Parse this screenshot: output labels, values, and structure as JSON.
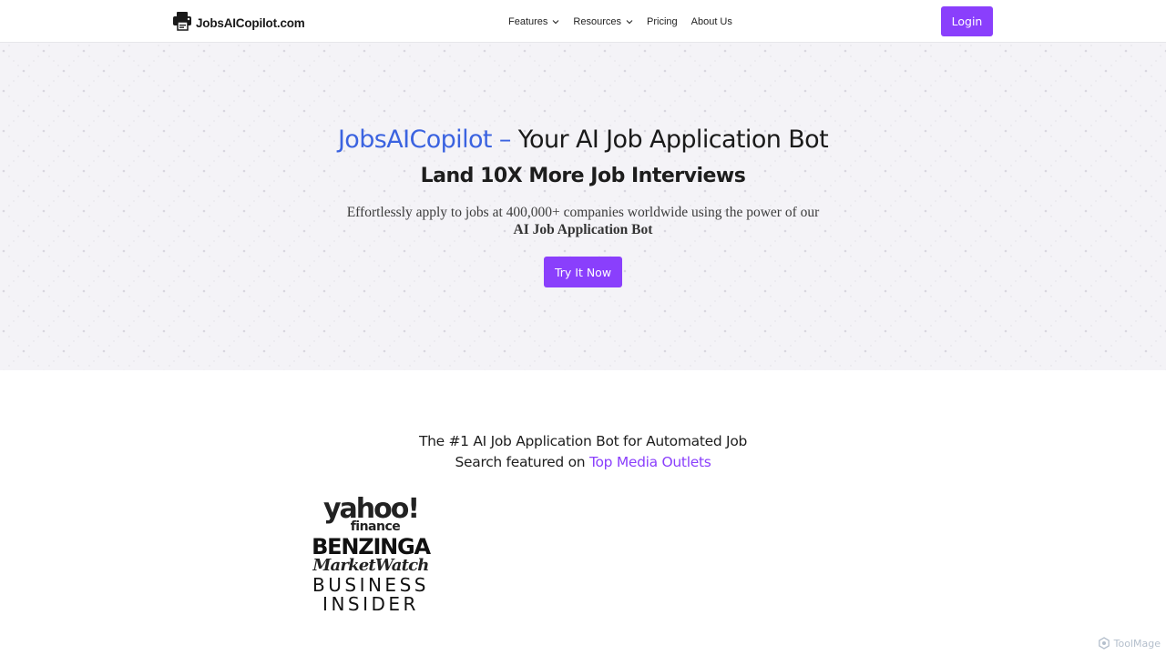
{
  "nav": {
    "logo_text": "JobsAICopilot.com",
    "logo_icon": "printer-logo-icon",
    "items": [
      {
        "label": "Features",
        "dropdown": true
      },
      {
        "label": "Resources",
        "dropdown": true
      },
      {
        "label": "Pricing",
        "dropdown": false
      },
      {
        "label": "About Us",
        "dropdown": false
      }
    ],
    "login_label": "Login"
  },
  "hero": {
    "title_brand": "JobsAICopilot –",
    "title_rest": " Your AI Job Application Bot",
    "subtitle": "Land 10X More Job Interviews",
    "description": "Effortlessly apply to jobs at 400,000+ companies worldwide using the power of our",
    "description_strong": "AI Job Application Bot",
    "cta_label": "Try It Now"
  },
  "featured": {
    "line1": "The #1 AI Job Application Bot for Automated Job",
    "line2_prefix": "Search featured on ",
    "line2_highlight": "Top Media Outlets"
  },
  "media_logos": {
    "yahoo_main": "yahoo!",
    "yahoo_sub": "finance",
    "benzinga": "BENZINGA",
    "marketwatch": "MarketWatch",
    "business": "BUSINESS",
    "insider": "INSIDER"
  },
  "watermark": "ToolMage",
  "colors": {
    "accent": "#8a3ffc",
    "brand_blue": "#3b63e0",
    "hero_bg": "#f4f3f7"
  }
}
